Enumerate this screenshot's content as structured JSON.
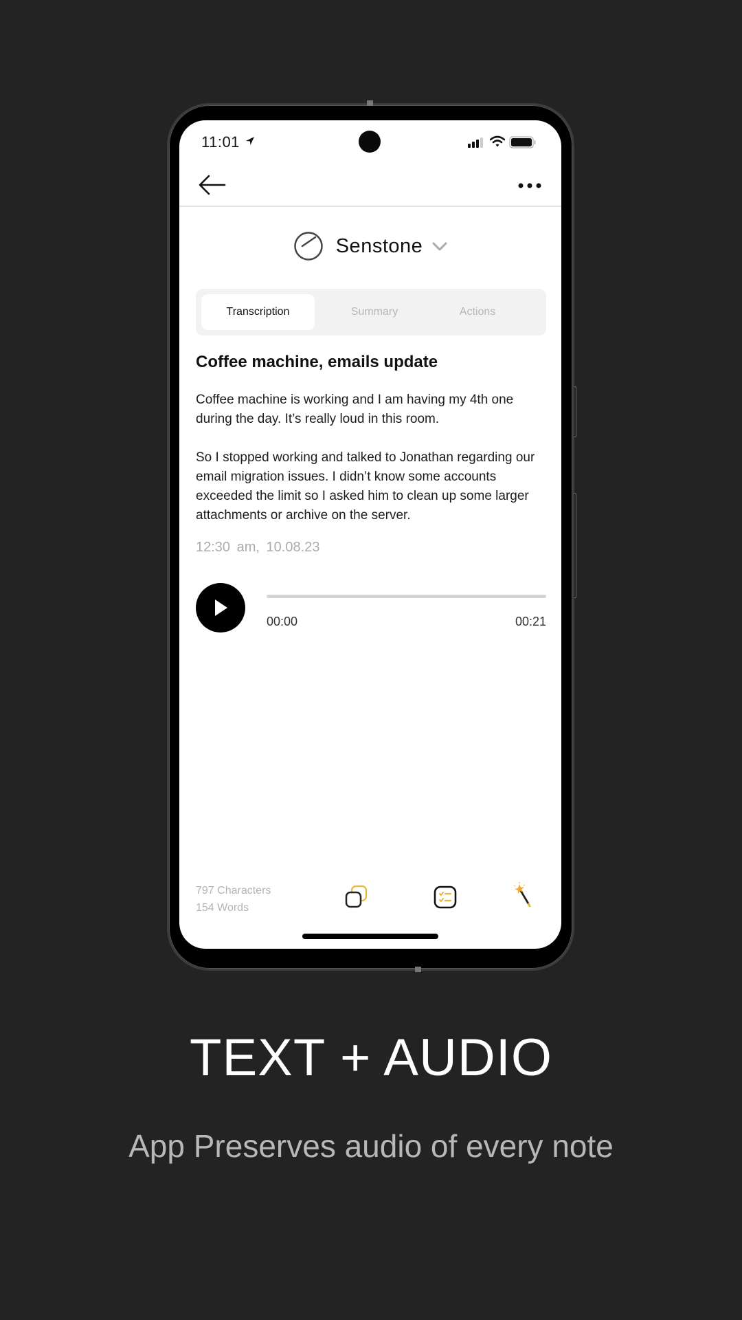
{
  "status_bar": {
    "time": "11:01"
  },
  "header": {
    "brand_name": "Senstone"
  },
  "tabs": [
    {
      "label": "Transcription",
      "active": true
    },
    {
      "label": "Summary",
      "active": false
    },
    {
      "label": "Actions",
      "active": false
    }
  ],
  "note": {
    "title": "Coffee machine, emails update",
    "paragraphs": [
      "Coffee machine is working and I am having my 4th one during the day. It’s really loud in this room.",
      "So I stopped working and talked to Jonathan regarding our email migration issues. I didn’t know some accounts exceeded the limit so I asked him to clean up some larger attachments or archive on the server."
    ],
    "time": "12:30 am,",
    "date": "10.08.23"
  },
  "player": {
    "current_time": "00:00",
    "total_time": "00:21",
    "progress": 0
  },
  "footer": {
    "characters": "797 Characters",
    "words": "154 Words"
  },
  "promo": {
    "headline": "TEXT + AUDIO",
    "subline": "App Preserves audio of every note"
  },
  "colors": {
    "background": "#232323",
    "accent": "#E8B73A",
    "inactive_tab": "#B5B5B5",
    "muted_text": "#ABABAB"
  }
}
